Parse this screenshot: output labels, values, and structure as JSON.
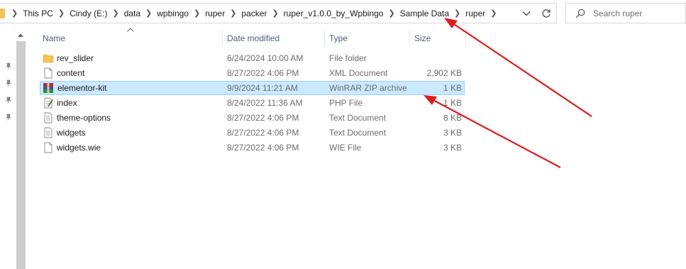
{
  "address_bar": {
    "crumbs": [
      "This PC",
      "Cindy (E:)",
      "data",
      "wpbingo",
      "ruper",
      "packer",
      "ruper_v1.0.0_by_Wpbingo",
      "Sample Data",
      "ruper"
    ]
  },
  "search": {
    "placeholder": "Search ruper"
  },
  "columns": {
    "name": "Name",
    "date": "Date modified",
    "type": "Type",
    "size": "Size"
  },
  "files": [
    {
      "name": "rev_slider",
      "date": "6/24/2024 10:00 AM",
      "type": "File folder",
      "size": "",
      "icon": "folder-icon"
    },
    {
      "name": "content",
      "date": "8/27/2022 4:06 PM",
      "type": "XML Document",
      "size": "2,902 KB",
      "icon": "xml-file-icon"
    },
    {
      "name": "elementor-kit",
      "date": "9/9/2024 11:21 AM",
      "type": "WinRAR ZIP archive",
      "size": "1 KB",
      "icon": "winrar-archive-icon",
      "selected": true
    },
    {
      "name": "index",
      "date": "8/24/2022 11:36 AM",
      "type": "PHP File",
      "size": "1 KB",
      "icon": "php-file-icon"
    },
    {
      "name": "theme-options",
      "date": "8/27/2022 4:06 PM",
      "type": "Text Document",
      "size": "8 KB",
      "icon": "text-file-icon"
    },
    {
      "name": "widgets",
      "date": "8/27/2022 4:06 PM",
      "type": "Text Document",
      "size": "3 KB",
      "icon": "text-file-icon"
    },
    {
      "name": "widgets.wie",
      "date": "8/27/2022 4:06 PM",
      "type": "WIE File",
      "size": "3 KB",
      "icon": "generic-file-icon"
    }
  ],
  "colors": {
    "selection_bg": "#cce8ff",
    "selection_border": "#99d1ff",
    "annotation_arrow": "#e01b1b",
    "header_text": "#4c607a"
  }
}
